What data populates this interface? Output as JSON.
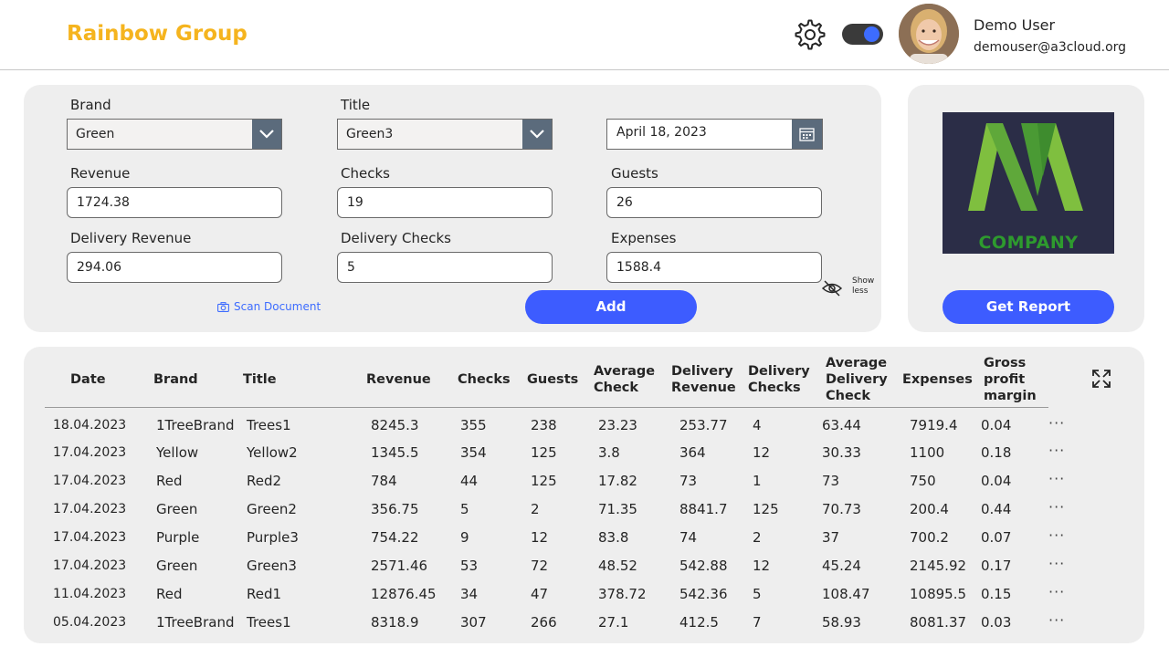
{
  "header": {
    "brand": "Rainbow Group",
    "user_name": "Demo User",
    "user_email": "demouser@a3cloud.org"
  },
  "form": {
    "brand_label": "Brand",
    "brand_value": "Green",
    "title_label": "Title",
    "title_value": "Green3",
    "date_value": "April 18, 2023",
    "revenue_label": "Revenue",
    "revenue_value": "1724.38",
    "checks_label": "Checks",
    "checks_value": "19",
    "guests_label": "Guests",
    "guests_value": "26",
    "delivery_revenue_label": "Delivery Revenue",
    "delivery_revenue_value": "294.06",
    "delivery_checks_label": "Delivery Checks",
    "delivery_checks_value": "5",
    "expenses_label": "Expenses",
    "expenses_value": "1588.4",
    "scan_label": "Scan Document",
    "add_label": "Add",
    "show_less_1": "Show",
    "show_less_2": "less"
  },
  "logo_panel": {
    "logo_text": "COMPANY",
    "report_label": "Get Report"
  },
  "table": {
    "columns": [
      "Date",
      "Brand",
      "Title",
      "Revenue",
      "Checks",
      "Guests",
      "Average Check",
      "Delivery Revenue",
      "Delivery Checks",
      "Average Delivery Check",
      "Expenses",
      "Gross profit margin"
    ],
    "column_lines": [
      [
        "Date"
      ],
      [
        "Brand"
      ],
      [
        "Title"
      ],
      [
        "Revenue"
      ],
      [
        "Checks"
      ],
      [
        "Guests"
      ],
      [
        "Average",
        "Check"
      ],
      [
        "Delivery",
        "Revenue"
      ],
      [
        "Delivery",
        "Checks"
      ],
      [
        "Average",
        "Delivery",
        "Check"
      ],
      [
        "Expenses"
      ],
      [
        "Gross",
        "profit",
        "margin"
      ]
    ],
    "more_label": "···",
    "rows": [
      [
        "18.04.2023",
        "1TreeBrand",
        "Trees1",
        "8245.3",
        "355",
        "238",
        "23.23",
        "253.77",
        "4",
        "63.44",
        "7919.4",
        "0.04"
      ],
      [
        "17.04.2023",
        "Yellow",
        "Yellow2",
        "1345.5",
        "354",
        "125",
        "3.8",
        "364",
        "12",
        "30.33",
        "1100",
        "0.18"
      ],
      [
        "17.04.2023",
        "Red",
        "Red2",
        "784",
        "44",
        "125",
        "17.82",
        "73",
        "1",
        "73",
        "750",
        "0.04"
      ],
      [
        "17.04.2023",
        "Green",
        "Green2",
        "356.75",
        "5",
        "2",
        "71.35",
        "8841.7",
        "125",
        "70.73",
        "200.4",
        "0.44"
      ],
      [
        "17.04.2023",
        "Purple",
        "Purple3",
        "754.22",
        "9",
        "12",
        "83.8",
        "74",
        "2",
        "37",
        "700.2",
        "0.07"
      ],
      [
        "17.04.2023",
        "Green",
        "Green3",
        "2571.46",
        "53",
        "72",
        "48.52",
        "542.88",
        "12",
        "45.24",
        "2145.92",
        "0.17"
      ],
      [
        "11.04.2023",
        "Red",
        "Red1",
        "12876.45",
        "34",
        "47",
        "378.72",
        "542.36",
        "5",
        "108.47",
        "10895.5",
        "0.15"
      ],
      [
        "05.04.2023",
        "1TreeBrand",
        "Trees1",
        "8318.9",
        "307",
        "266",
        "27.1",
        "412.5",
        "7",
        "58.93",
        "8081.37",
        "0.03"
      ]
    ]
  },
  "colors": {
    "brand_yellow": "#f5b41e",
    "accent_blue": "#3d5cff",
    "panel_bg": "#eeeeee",
    "dropdown_btn": "#5b6b7c"
  },
  "icons": [
    "gear-icon",
    "toggle-switch",
    "chevron-down-icon",
    "calendar-icon",
    "camera-icon",
    "eye-off-icon",
    "expand-icon",
    "more-icon"
  ]
}
